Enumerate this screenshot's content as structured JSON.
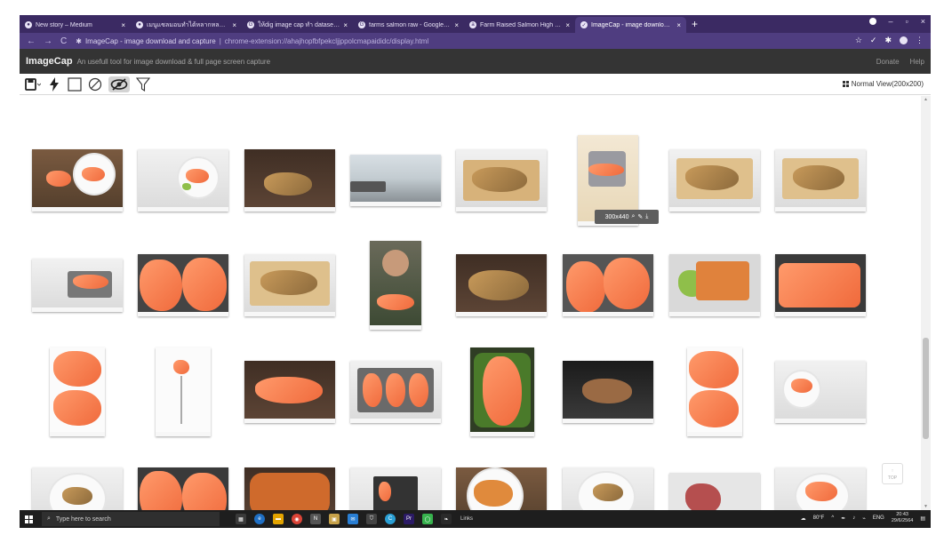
{
  "browser": {
    "tabs": [
      {
        "title": "New story – Medium",
        "icon": "medium-icon",
        "active": false
      },
      {
        "title": "เมนูแซลมอนทำได้หลากหลาย ... ",
        "icon": "medium-icon",
        "active": false
      },
      {
        "title": "ให้dig image cap ทำ dataset - ค้นห",
        "icon": "google-icon",
        "active": false
      },
      {
        "title": "farms salmon raw - Google Sear",
        "icon": "google-icon",
        "active": false
      },
      {
        "title": "Farm Raised Salmon High Resolu",
        "icon": "amazon-icon",
        "active": false
      },
      {
        "title": "ImageCap - image download and",
        "icon": "imagecap-icon",
        "active": true
      }
    ],
    "new_tab": "+",
    "address": {
      "site": "ImageCap - image download and capture",
      "separator": "|",
      "url": "chrome-extension://ahajhopfbfpekcljjppolcmapaididc/display.html"
    }
  },
  "app": {
    "brand": "ImageCap",
    "tagline": "An usefull tool for image download & full page screen capture",
    "links": [
      "Donate",
      "Help"
    ],
    "view_mode": "Normal View(200x200)"
  },
  "tooltip": {
    "size": "300x440"
  },
  "top_button": {
    "arrow": "↑",
    "label": "TOP"
  },
  "taskbar": {
    "search_placeholder": "Type here to search",
    "links_label": "Links",
    "weather": "80°F",
    "lang": "ENG",
    "time": "20:43",
    "date": "29/6/2564"
  },
  "colors": {
    "tabstrip": "#3b2a63",
    "addressbar": "#4f3d80",
    "appheader": "#343434",
    "taskbar": "#1e1e1e"
  }
}
